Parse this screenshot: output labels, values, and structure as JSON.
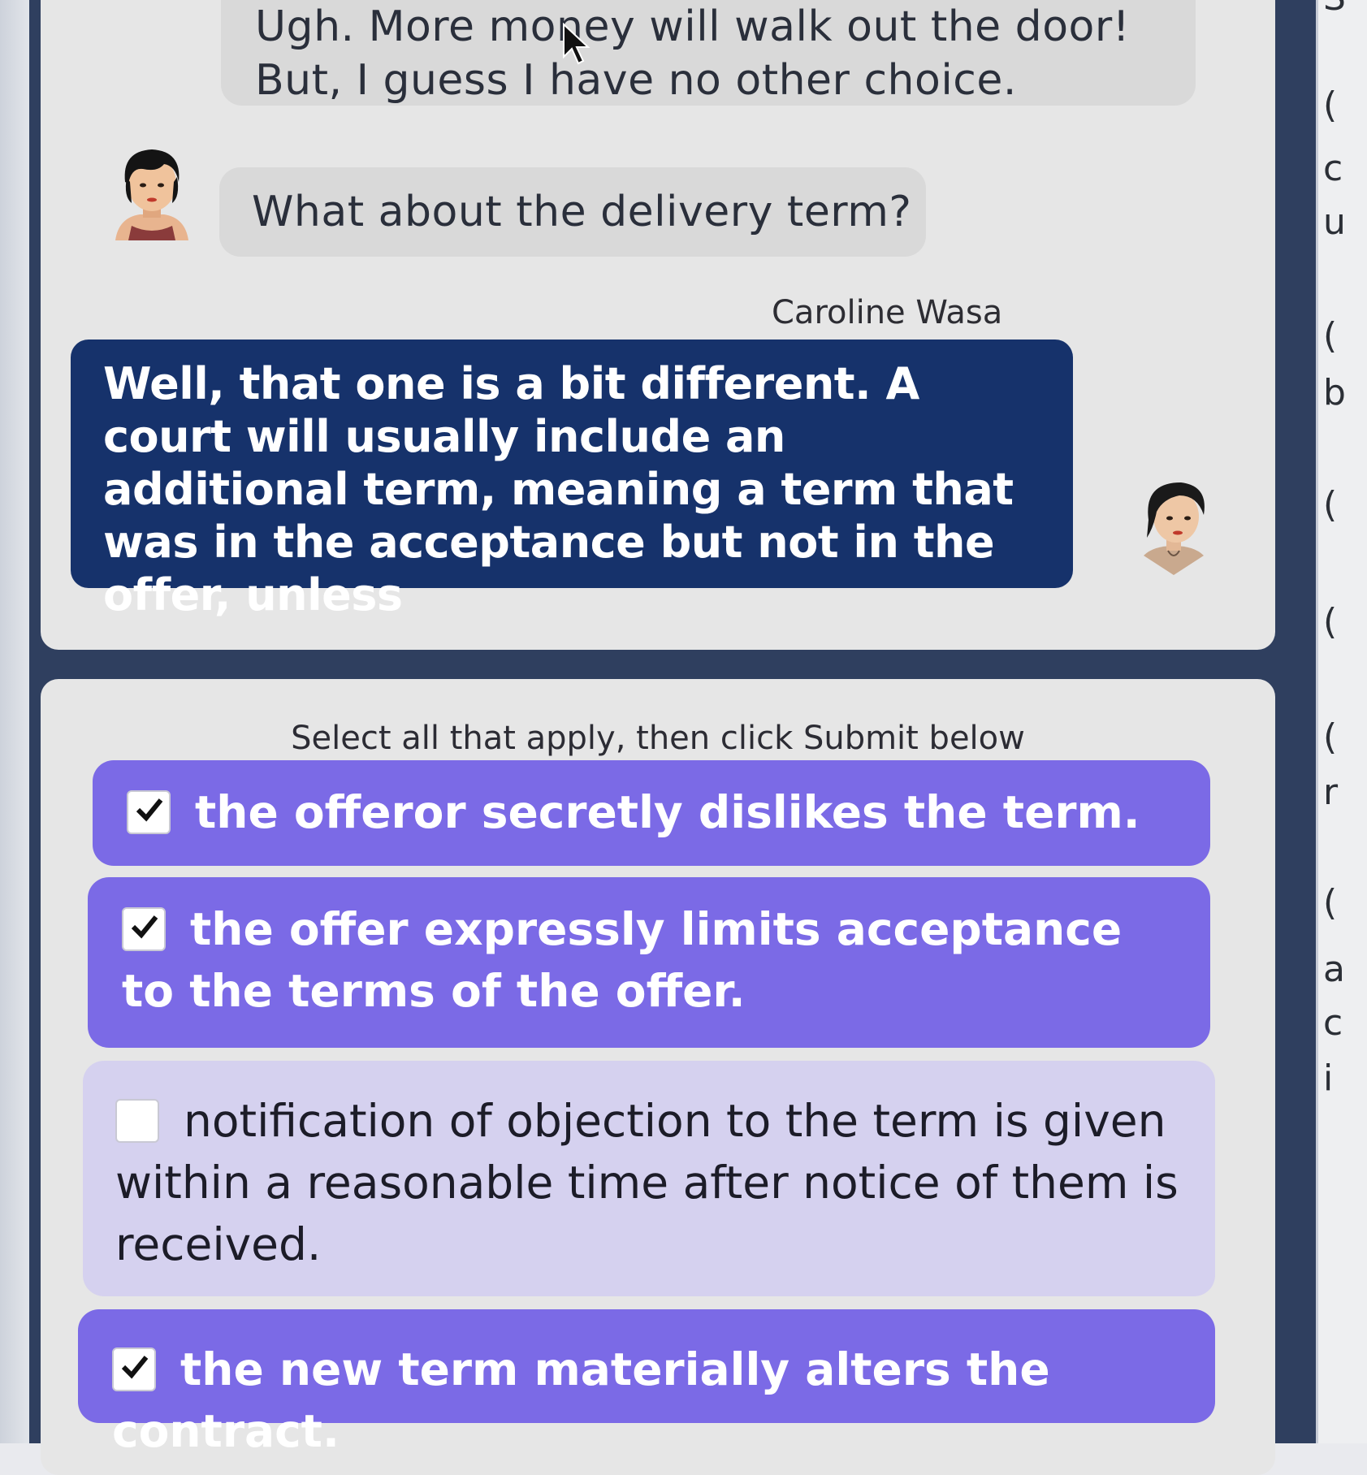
{
  "chat": {
    "user_message_1": "Ugh. More money will walk out the door! But, I guess I have no other choice.",
    "user_message_2": "What about the delivery term?",
    "speaker_name": "Caroline Wasa",
    "speaker_message": "Well, that one is a bit different. A court will usually include an additional term, meaning a term that was in the acceptance but not in the offer, unless",
    "user_avatar_icon": "woman-avatar-icon",
    "speaker_avatar_icon": "woman-avatar-icon"
  },
  "quiz": {
    "prompt": "Select all that apply, then click Submit below",
    "options": [
      {
        "label": "the offeror secretly dislikes the term.",
        "checked": true
      },
      {
        "label": "the offer expressly limits acceptance to the terms of the offer.",
        "checked": true
      },
      {
        "label": "notification of objection to the term is given within a reasonable time after notice of them is received.",
        "checked": false
      },
      {
        "label": "the new term materially alters the contract.",
        "checked": true
      }
    ]
  },
  "colors": {
    "frame": "#2f3f5f",
    "speaker_bubble": "#16326b",
    "option_selected": "#7b6ae6",
    "option_unselected": "#d5d1ef"
  },
  "right_panel_glyphs": [
    "S",
    "(",
    "c",
    "u",
    "(",
    "b",
    "(",
    "(",
    "(",
    "r",
    "(",
    "a",
    "c",
    "i"
  ]
}
